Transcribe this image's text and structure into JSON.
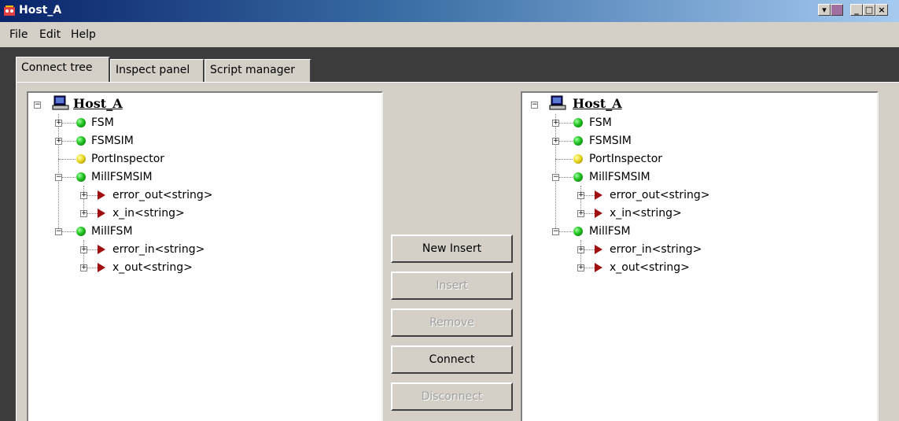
{
  "window": {
    "title": "Host_A",
    "controls": [
      "minimize",
      "maximize",
      "close"
    ]
  },
  "menu": [
    "File",
    "Edit",
    "Help"
  ],
  "tabs": [
    {
      "label": "Connect tree",
      "active": true
    },
    {
      "label": "Inspect panel",
      "active": false
    },
    {
      "label": "Script manager",
      "active": false
    }
  ],
  "tree": {
    "root": "Host_A",
    "nodes": [
      {
        "label": "FSM",
        "status": "green",
        "expander": "+"
      },
      {
        "label": "FSMSIM",
        "status": "green",
        "expander": "+"
      },
      {
        "label": "PortInspector",
        "status": "yellow",
        "expander": ""
      },
      {
        "label": "MillFSMSIM",
        "status": "green",
        "expander": "-",
        "ports": [
          "error_out<string>",
          "x_in<string>"
        ]
      },
      {
        "label": "MillFSM",
        "status": "green",
        "expander": "-",
        "ports": [
          "error_in<string>",
          "x_out<string>"
        ]
      }
    ]
  },
  "buttons": [
    {
      "label": "New Insert",
      "enabled": true
    },
    {
      "label": "Insert",
      "enabled": false
    },
    {
      "label": "Remove",
      "enabled": false
    },
    {
      "label": "Connect",
      "enabled": true
    },
    {
      "label": "Disconnect",
      "enabled": false
    }
  ],
  "colors": {
    "status_green": "#20c020",
    "status_yellow": "#e8d820",
    "port_arrow": "#a01010",
    "titlebar": "#0a246a"
  }
}
